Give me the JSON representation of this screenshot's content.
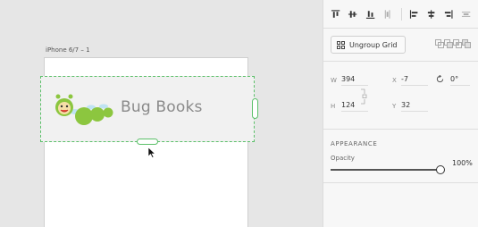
{
  "artboard": {
    "label": "iPhone 6/7 – 1"
  },
  "banner": {
    "title": "Bug Books"
  },
  "grid": {
    "ungroup_label": "Ungroup Grid"
  },
  "transform": {
    "w_label": "W",
    "w_value": "394",
    "x_label": "X",
    "x_value": "-7",
    "h_label": "H",
    "h_value": "124",
    "y_label": "Y",
    "y_value": "32",
    "rotation_value": "0°"
  },
  "appearance": {
    "section_title": "APPEARANCE",
    "opacity_label": "Opacity",
    "opacity_value": "100%",
    "opacity": 1.0
  },
  "colors": {
    "selection": "#5cc06a",
    "caterpillar": "#8cc63f"
  }
}
